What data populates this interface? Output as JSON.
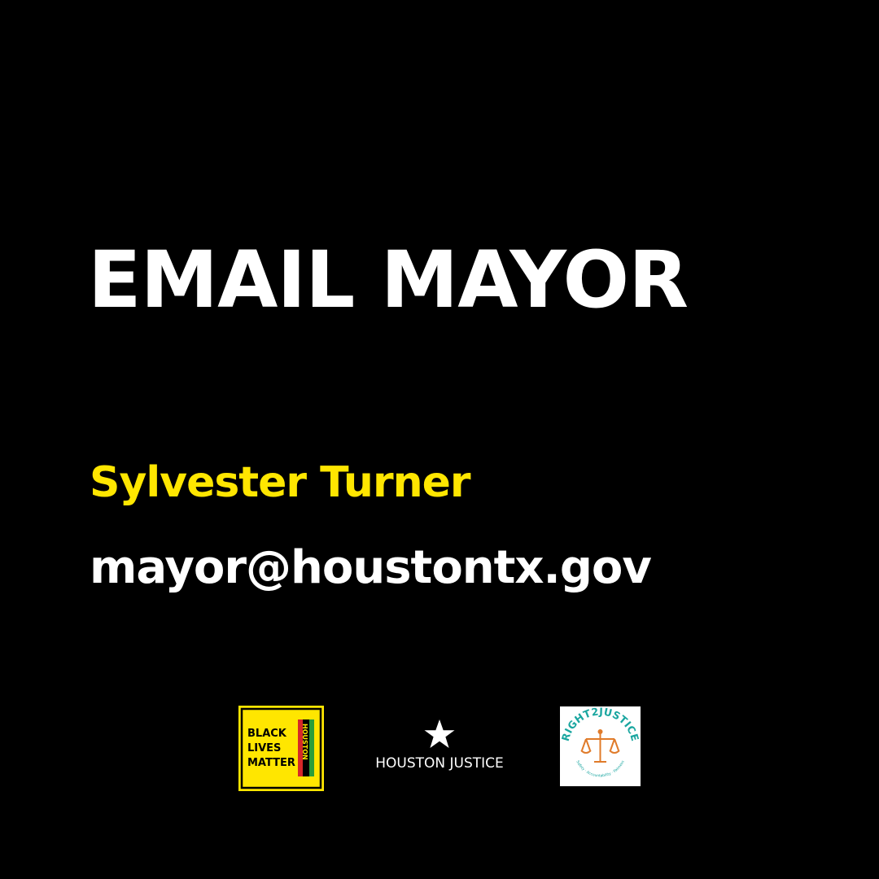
{
  "headline": "EMAIL MAYOR",
  "official_name": "Sylvester Turner",
  "official_email": "mayor@houstontx.gov",
  "colors": {
    "background": "#000000",
    "headline": "#ffffff",
    "name": "#ffe600",
    "email": "#ffffff"
  },
  "logos": {
    "blm": {
      "icon": "black-lives-matter-houston-logo",
      "lines": [
        "BLACK",
        "LIVES",
        "MATTER"
      ],
      "side_text": "HOUSTON"
    },
    "houston_justice": {
      "icon": "star-icon",
      "text": "HOUSTON JUSTICE"
    },
    "right2justice": {
      "icon": "scales-of-justice-icon",
      "text": "RIGHT2JUSTICE",
      "tagline": "Safety · Accountability · Fairness"
    }
  }
}
